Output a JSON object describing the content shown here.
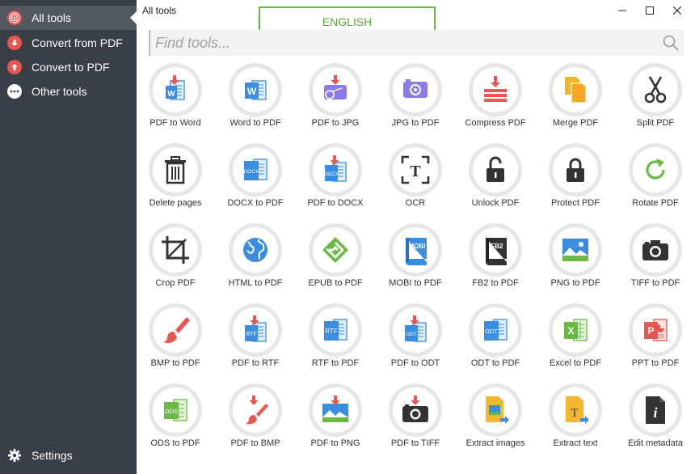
{
  "window": {
    "title": "All tools"
  },
  "language": {
    "label": "ENGLISH"
  },
  "search": {
    "placeholder": "Find tools..."
  },
  "sidebar": {
    "items": [
      {
        "label": "All tools",
        "icon": "target-icon",
        "color": "#e8564f",
        "active": true
      },
      {
        "label": "Convert from PDF",
        "icon": "arrow-down-icon",
        "color": "#e8564f",
        "active": false
      },
      {
        "label": "Convert to PDF",
        "icon": "arrow-up-icon",
        "color": "#e8564f",
        "active": false
      },
      {
        "label": "Other tools",
        "icon": "more-icon",
        "color": "#ffffff",
        "active": false
      }
    ],
    "settings": {
      "label": "Settings",
      "icon": "gear-icon"
    }
  },
  "colors": {
    "sidebar_bg": "#3a3e46",
    "accent_red": "#e8564f",
    "accent_blue": "#3a8de0",
    "accent_green": "#6bb944",
    "accent_purple": "#8a7be8",
    "accent_orange": "#f5a623"
  },
  "tools": [
    {
      "label": "PDF to Word",
      "icon": "pdf-to-word-icon"
    },
    {
      "label": "Word to PDF",
      "icon": "word-to-pdf-icon"
    },
    {
      "label": "PDF to JPG",
      "icon": "pdf-to-jpg-icon"
    },
    {
      "label": "JPG to PDF",
      "icon": "jpg-to-pdf-icon"
    },
    {
      "label": "Compress PDF",
      "icon": "compress-icon"
    },
    {
      "label": "Merge PDF",
      "icon": "merge-icon"
    },
    {
      "label": "Split PDF",
      "icon": "scissors-icon"
    },
    {
      "label": "Delete pages",
      "icon": "trash-icon"
    },
    {
      "label": "DOCX to PDF",
      "icon": "docx-to-pdf-icon"
    },
    {
      "label": "PDF to DOCX",
      "icon": "pdf-to-docx-icon"
    },
    {
      "label": "OCR",
      "icon": "ocr-icon"
    },
    {
      "label": "Unlock PDF",
      "icon": "unlock-icon"
    },
    {
      "label": "Protect PDF",
      "icon": "lock-icon"
    },
    {
      "label": "Rotate PDF",
      "icon": "rotate-icon"
    },
    {
      "label": "Crop PDF",
      "icon": "crop-icon"
    },
    {
      "label": "HTML to PDF",
      "icon": "globe-icon"
    },
    {
      "label": "EPUB to PDF",
      "icon": "epub-icon"
    },
    {
      "label": "MOBI to PDF",
      "icon": "mobi-icon"
    },
    {
      "label": "FB2 to PDF",
      "icon": "fb2-icon"
    },
    {
      "label": "PNG to PDF",
      "icon": "image-icon"
    },
    {
      "label": "TIFF to PDF",
      "icon": "camera-icon"
    },
    {
      "label": "BMP to PDF",
      "icon": "brush-icon"
    },
    {
      "label": "PDF to RTF",
      "icon": "pdf-to-rtf-icon"
    },
    {
      "label": "RTF to PDF",
      "icon": "rtf-to-pdf-icon"
    },
    {
      "label": "PDF to ODT",
      "icon": "pdf-to-odt-icon"
    },
    {
      "label": "ODT to PDF",
      "icon": "odt-to-pdf-icon"
    },
    {
      "label": "Excel to PDF",
      "icon": "excel-icon"
    },
    {
      "label": "PPT to PDF",
      "icon": "powerpoint-icon"
    },
    {
      "label": "ODS to PDF",
      "icon": "ods-icon"
    },
    {
      "label": "PDF to BMP",
      "icon": "pdf-to-bmp-icon"
    },
    {
      "label": "PDF to PNG",
      "icon": "pdf-to-png-icon"
    },
    {
      "label": "PDF to TIFF",
      "icon": "pdf-to-tiff-icon"
    },
    {
      "label": "Extract images",
      "icon": "extract-images-icon"
    },
    {
      "label": "Extract text",
      "icon": "extract-text-icon"
    },
    {
      "label": "Edit metadata",
      "icon": "info-icon"
    }
  ],
  "icon_text": {
    "word": "W",
    "docx": "DOCX",
    "ocr": "T",
    "mobi": "MOBI",
    "fb2": "FB2",
    "rtf": "RTF",
    "odt": "ODT",
    "excel": "X",
    "ppt": "P",
    "ods": "ODS",
    "text": "T",
    "info": "i"
  }
}
